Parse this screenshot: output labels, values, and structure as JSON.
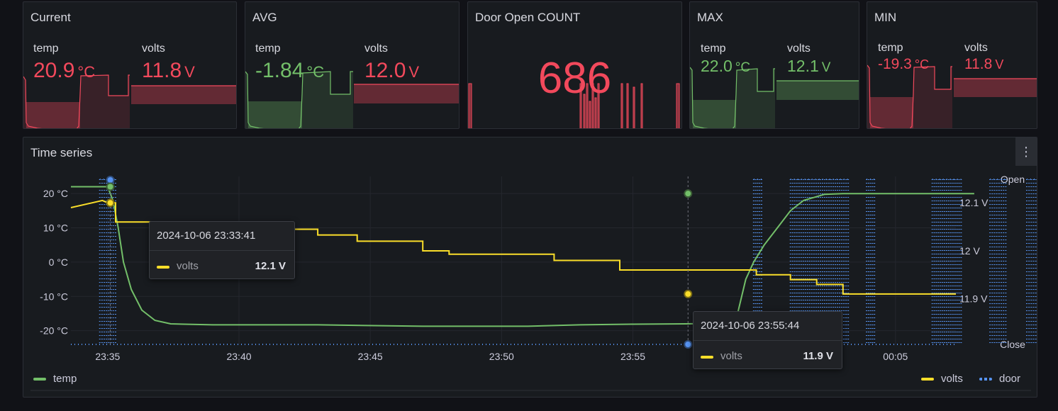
{
  "colors": {
    "background": "#111217",
    "panel": "#181b1f",
    "red": "#f2495c",
    "green": "#73bf69",
    "yellow": "#fade2a",
    "blue": "#5794f2"
  },
  "stat_panels": [
    {
      "title": "Current",
      "items": [
        {
          "label": "temp",
          "value": "20.9",
          "unit": "°C",
          "color": "red"
        },
        {
          "label": "volts",
          "value": "11.8",
          "unit": "V",
          "color": "red"
        }
      ]
    },
    {
      "title": "AVG",
      "items": [
        {
          "label": "temp",
          "value": "-1.84",
          "unit": "°C",
          "color": "green"
        },
        {
          "label": "volts",
          "value": "12.0",
          "unit": "V",
          "color": "red"
        }
      ]
    },
    {
      "title": "Door Open COUNT",
      "value": "686"
    },
    {
      "title": "MAX",
      "items": [
        {
          "label": "temp",
          "value": "22.0",
          "unit": "°C",
          "color": "green"
        },
        {
          "label": "volts",
          "value": "12.1",
          "unit": "V",
          "color": "green"
        }
      ]
    },
    {
      "title": "MIN",
      "items": [
        {
          "label": "temp",
          "value": "-19.3",
          "unit": "°C",
          "color": "red"
        },
        {
          "label": "volts",
          "value": "11.8",
          "unit": "V",
          "color": "red"
        }
      ]
    }
  ],
  "timeseries": {
    "title": "Time series",
    "menu_icon": "kebab-menu-icon",
    "tooltips": [
      {
        "time": "2024-10-06 23:33:41",
        "series": "volts",
        "value": "12.1 V"
      },
      {
        "time": "2024-10-06 23:55:44",
        "series": "volts",
        "value": "11.9 V"
      }
    ],
    "legend_left": [
      {
        "name": "temp",
        "color": "#73bf69",
        "style": "solid"
      }
    ],
    "legend_right": [
      {
        "name": "volts",
        "color": "#fade2a",
        "style": "solid"
      },
      {
        "name": "door",
        "color": "#5794f2",
        "style": "dotted"
      }
    ]
  },
  "chart_data": {
    "type": "line",
    "x_ticks": [
      "23:35",
      "23:40",
      "23:45",
      "23:50",
      "23:55",
      "00:05"
    ],
    "x_range_minutes": [
      -1.4,
      32.3
    ],
    "y_left": {
      "ticks": [
        "20 °C",
        "10 °C",
        "0 °C",
        "-10 °C",
        "-20 °C"
      ],
      "tick_values": [
        20,
        10,
        0,
        -10,
        -20
      ],
      "range": [
        -24,
        25
      ]
    },
    "y_right_volts": {
      "ticks": [
        "12.1 V",
        "12 V",
        "11.9 V"
      ],
      "tick_values": [
        12.1,
        12.0,
        11.9
      ],
      "range": [
        11.805,
        12.155
      ]
    },
    "y_right_door": {
      "ticks": [
        "Open",
        "Close"
      ],
      "tick_values": [
        1,
        0
      ]
    },
    "grid": true,
    "series": [
      {
        "name": "temp",
        "unit": "°C",
        "axis": "left",
        "minutes": [
          -1.4,
          -0.2,
          0,
          0.2,
          0.4,
          0.6,
          0.9,
          1.3,
          1.8,
          2.4,
          4,
          8,
          12,
          16,
          18,
          20,
          22,
          23.9,
          24.3,
          24.6,
          25,
          25.5,
          26,
          26.5,
          27.3,
          28,
          33
        ],
        "values": [
          22,
          22,
          22,
          18,
          10,
          0,
          -8,
          -14,
          -17,
          -18,
          -18.3,
          -18.3,
          -18.7,
          -18.7,
          -18.3,
          -18.1,
          -18.0,
          -17.8,
          -5,
          0,
          5,
          10,
          15,
          18,
          19.8,
          20,
          20
        ]
      },
      {
        "name": "volts",
        "unit": "V",
        "axis": "right",
        "minutes": [
          -1.4,
          -0.2,
          0,
          0.3,
          1.5,
          2.5,
          3,
          7.2,
          8,
          9.5,
          11,
          12,
          13,
          15,
          17,
          18,
          19,
          19.5,
          20.5,
          22,
          23,
          23.5,
          24.7,
          25.5,
          26,
          27,
          28,
          29,
          30,
          32.2,
          32.3
        ],
        "values": [
          12.09,
          12.105,
          12.1,
          12.06,
          12.06,
          12.06,
          12.045,
          12.045,
          12.033,
          12.02,
          12.02,
          12.0,
          11.993,
          11.993,
          11.98,
          11.98,
          11.98,
          11.96,
          11.96,
          11.96,
          11.96,
          11.96,
          11.95,
          11.95,
          11.94,
          11.93,
          11.91,
          11.91,
          11.91,
          11.91,
          11.91
        ]
      },
      {
        "name": "door",
        "axis": "state",
        "style": "dotted",
        "open_intervals_minutes": [
          [
            -0.3,
            0.3
          ],
          [
            24.6,
            24.9
          ],
          [
            26.0,
            28.2
          ],
          [
            28.9,
            29.2
          ],
          [
            31.4,
            32.5
          ],
          [
            33.6,
            34.2
          ],
          [
            35.0,
            35.6
          ],
          [
            36.9,
            37.1
          ],
          [
            38.3,
            38.5
          ],
          [
            39.5,
            39.7
          ]
        ]
      }
    ]
  }
}
